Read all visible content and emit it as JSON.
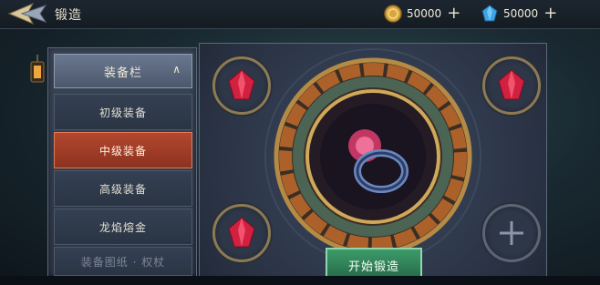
{
  "header": {
    "title": "锻造"
  },
  "resources": [
    {
      "icon": "gold-coin-icon",
      "value": "50000"
    },
    {
      "icon": "blue-crystal-icon",
      "value": "50000"
    }
  ],
  "category": {
    "header_label": "装备栏",
    "items": [
      {
        "label": "初级装备",
        "state": "normal"
      },
      {
        "label": "中级装备",
        "state": "active"
      },
      {
        "label": "高级装备",
        "state": "normal"
      },
      {
        "label": "龙焰熔金",
        "state": "normal"
      },
      {
        "label": "装备图纸 · 权杖",
        "state": "dim"
      }
    ]
  },
  "forge": {
    "start_label": "开始锻造",
    "center_item": "ring-icon"
  },
  "colors": {
    "active": "#b3472e",
    "start": "#2e8a5a",
    "gold": "#c9a04f"
  }
}
